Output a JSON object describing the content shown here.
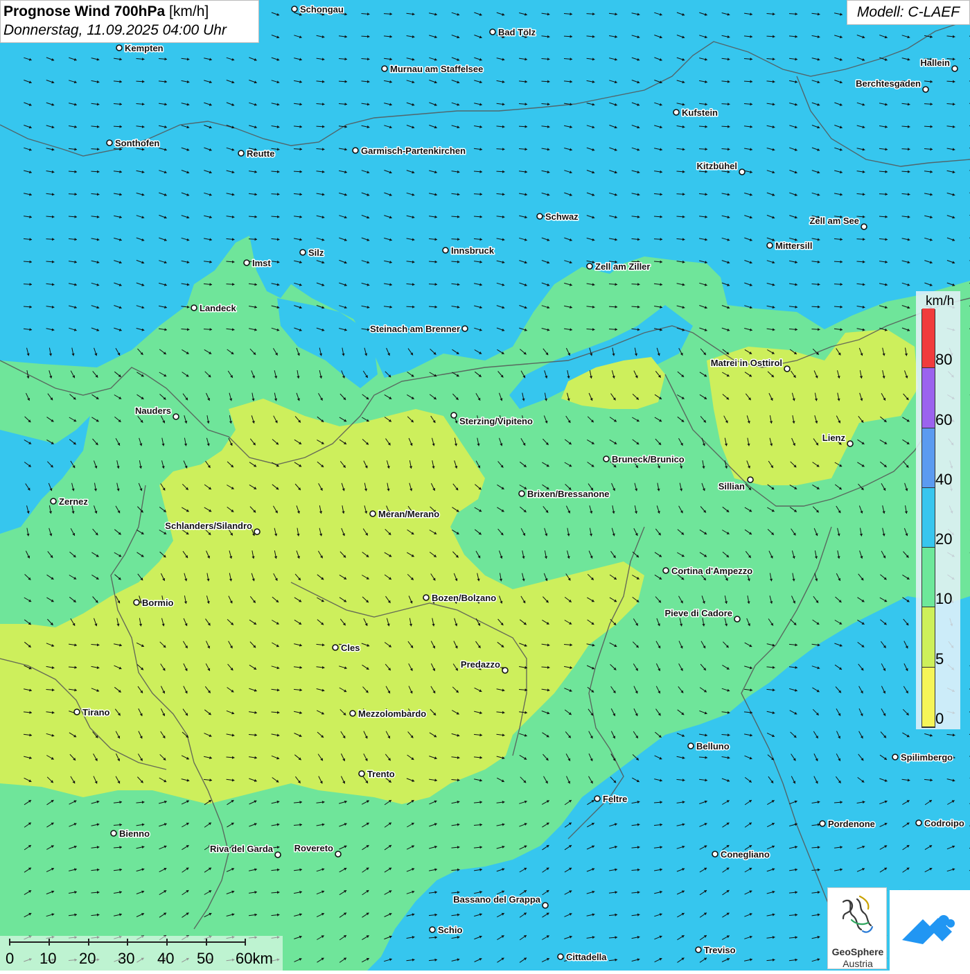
{
  "header": {
    "title_main": "Prognose Wind 700hPa",
    "title_unit": "[km/h]",
    "subtitle": "Donnerstag, 11.09.2025 04:00 Uhr"
  },
  "model": {
    "label": "Modell: C-LAEF"
  },
  "legend": {
    "unit": "km/h",
    "segments": [
      {
        "from": 0,
        "to": 5,
        "color": "#f5f558"
      },
      {
        "from": 5,
        "to": 10,
        "color": "#cdf05a"
      },
      {
        "from": 10,
        "to": 20,
        "color": "#6de89a"
      },
      {
        "from": 20,
        "to": 40,
        "color": "#38c6ee"
      },
      {
        "from": 40,
        "to": 60,
        "color": "#5b9bf0"
      },
      {
        "from": 60,
        "to": 80,
        "color": "#9b63ee"
      },
      {
        "from": 80,
        "to": 100,
        "color": "#f03c3c"
      }
    ],
    "tick_labels": [
      "0",
      "5",
      "10",
      "20",
      "40",
      "60",
      "80"
    ]
  },
  "scale": {
    "labels": [
      "0",
      "10",
      "20",
      "30",
      "40",
      "50",
      "60km"
    ]
  },
  "cities": [
    {
      "name": "Schongau"
    },
    {
      "name": "Bad Tölz"
    },
    {
      "name": "Kempten"
    },
    {
      "name": "Murnau am Staffelsee"
    },
    {
      "name": "Hallein"
    },
    {
      "name": "Berchtesgaden"
    },
    {
      "name": "Kufstein"
    },
    {
      "name": "Sonthofen"
    },
    {
      "name": "Reutte"
    },
    {
      "name": "Garmisch-Partenkirchen"
    },
    {
      "name": "Kitzbühel"
    },
    {
      "name": "Schwaz"
    },
    {
      "name": "Zell am See"
    },
    {
      "name": "Mittersill"
    },
    {
      "name": "Silz"
    },
    {
      "name": "Innsbruck"
    },
    {
      "name": "Imst"
    },
    {
      "name": "Zell am Ziller"
    },
    {
      "name": "Landeck"
    },
    {
      "name": "Steinach am Brenner"
    },
    {
      "name": "Matrei in Osttirol"
    },
    {
      "name": "Nauders"
    },
    {
      "name": "Sterzing/Vipiteno"
    },
    {
      "name": "Lienz"
    },
    {
      "name": "Bruneck/Brunico"
    },
    {
      "name": "Sillian"
    },
    {
      "name": "Zernez"
    },
    {
      "name": "Brixen/Bressanone"
    },
    {
      "name": "Meran/Merano"
    },
    {
      "name": "Schlanders/Silandro"
    },
    {
      "name": "Cortina d'Ampezzo"
    },
    {
      "name": "Bozen/Bolzano"
    },
    {
      "name": "Bormio"
    },
    {
      "name": "Pieve di Cadore"
    },
    {
      "name": "Cles"
    },
    {
      "name": "Predazzo"
    },
    {
      "name": "Tirano"
    },
    {
      "name": "Mezzolombardo"
    },
    {
      "name": "Belluno"
    },
    {
      "name": "Spilimbergo"
    },
    {
      "name": "Trento"
    },
    {
      "name": "Feltre"
    },
    {
      "name": "Pordenone"
    },
    {
      "name": "Codroipo"
    },
    {
      "name": "Bienno"
    },
    {
      "name": "Riva del Garda"
    },
    {
      "name": "Rovereto"
    },
    {
      "name": "Conegliano"
    },
    {
      "name": "Bassano del Grappa"
    },
    {
      "name": "Schio"
    },
    {
      "name": "Treviso"
    },
    {
      "name": "Cittadella"
    }
  ],
  "logo": {
    "name": "GeoSphere",
    "sub": "Austria"
  },
  "colors": {
    "blue_field": "#36c6ee",
    "green_field": "#6fe59a",
    "yellow_field": "#cdef5c",
    "border": "#555555",
    "accent_logo": "#2196f3"
  }
}
